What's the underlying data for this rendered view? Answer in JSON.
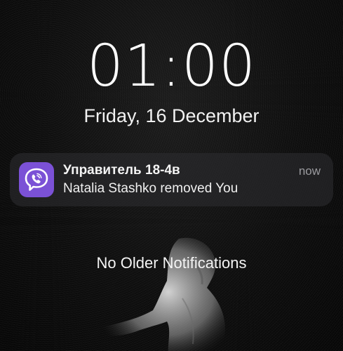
{
  "lockscreen": {
    "time": "01:00",
    "date": "Friday, 16 December"
  },
  "notification": {
    "app_icon": "viber-icon",
    "title": "Управитель 18-4в",
    "time": "now",
    "body": "Natalia Stashko removed You",
    "accent_color": "#7b51d6"
  },
  "footer": {
    "no_older_label": "No Older Notifications"
  }
}
